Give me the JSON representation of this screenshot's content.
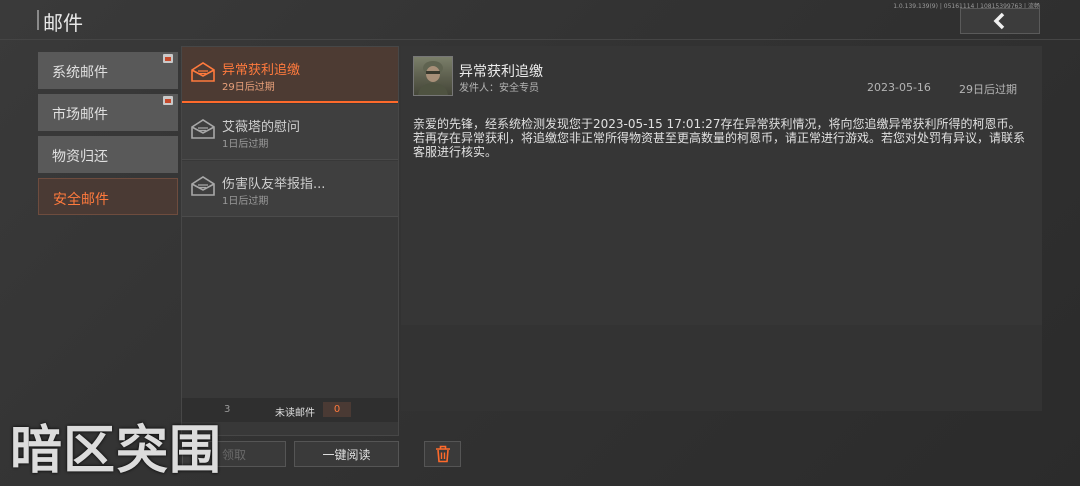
{
  "header": {
    "title": "邮件",
    "build_info": "1.0.139.139(9) | 05161114 | 10815399763 | 流畅"
  },
  "categories": [
    {
      "label": "系统邮件",
      "badge": true,
      "active": false
    },
    {
      "label": "市场邮件",
      "badge": true,
      "active": false
    },
    {
      "label": "物资归还",
      "badge": false,
      "active": false
    },
    {
      "label": "安全邮件",
      "badge": false,
      "active": true
    }
  ],
  "mail_list": [
    {
      "title": "异常获利追缴",
      "subtitle": "29日后过期",
      "selected": true
    },
    {
      "title": "艾薇塔的慰问",
      "subtitle": "1日后过期",
      "selected": false
    },
    {
      "title": "伤害队友举报指...",
      "subtitle": "1日后过期",
      "selected": false
    }
  ],
  "list_footer": {
    "total_count": "3",
    "unread_label": "未读邮件",
    "unread_count": "0"
  },
  "buttons": {
    "claim_all": "领取",
    "read_all": "一键阅读"
  },
  "detail": {
    "title": "异常获利追缴",
    "sender": "发件人：安全专员",
    "date": "2023-05-16",
    "expiry": "29日后过期",
    "body": "亲爱的先锋，经系统检测发现您于2023-05-15 17:01:27存在异常获利情况，将向您追缴异常获利所得的柯恩币。若再存在异常获利，将追缴您非正常所得物资甚至更高数量的柯恩币，请正常进行游戏。若您对处罚有异议，请联系客服进行核实。"
  },
  "logo_text": "暗区突围",
  "colors": {
    "accent": "#ff6a2b",
    "background": "#333333"
  }
}
